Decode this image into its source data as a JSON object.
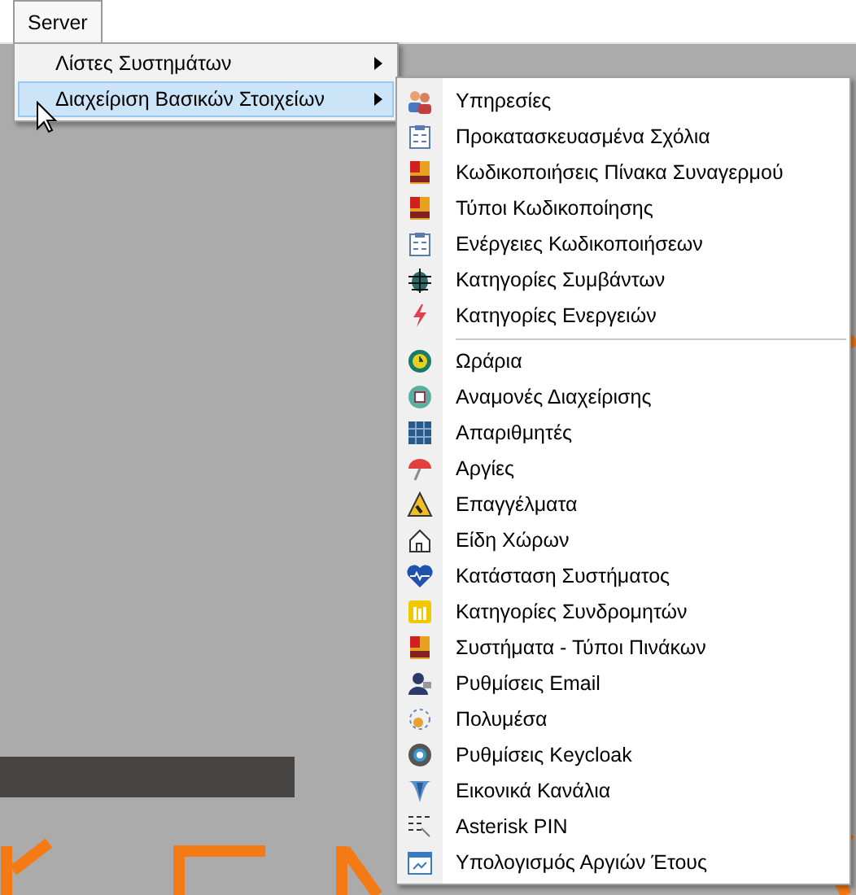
{
  "menubar": [
    {
      "label": "Server",
      "selected": true
    }
  ],
  "menu": {
    "items": [
      {
        "label": "Λίστες Συστημάτων",
        "selected": false
      },
      {
        "label": "Διαχείριση Βασικών Στοιχείων",
        "selected": true
      }
    ]
  },
  "submenu": {
    "groups": [
      [
        {
          "label": "Υπηρεσίες"
        },
        {
          "label": "Προκατασκευασμένα Σχόλια"
        },
        {
          "label": "Κωδικοποιήσεις Πίνακα Συναγερμού"
        },
        {
          "label": "Τύποι Κωδικοποίησης"
        },
        {
          "label": "Ενέργειες Κωδικοποιήσεων"
        },
        {
          "label": "Κατηγορίες Συμβάντων"
        },
        {
          "label": "Κατηγορίες Ενεργειών"
        }
      ],
      [
        {
          "label": "Ωράρια"
        },
        {
          "label": "Αναμονές Διαχείρισης"
        },
        {
          "label": "Απαριθμητές"
        },
        {
          "label": "Αργίες"
        },
        {
          "label": "Επαγγέλματα"
        },
        {
          "label": "Είδη Χώρων"
        },
        {
          "label": "Κατάσταση Συστήματος"
        },
        {
          "label": "Κατηγορίες Συνδρομητών"
        },
        {
          "label": "Συστήματα - Τύποι Πινάκων"
        },
        {
          "label": "Ρυθμίσεις Email"
        },
        {
          "label": "Πολυμέσα"
        },
        {
          "label": "Ρυθμίσεις Keycloak"
        },
        {
          "label": "Εικονικά Κανάλια"
        },
        {
          "label": "Asterisk PIN"
        },
        {
          "label": "Υπολογισμός Αργιών Έτους"
        }
      ]
    ]
  }
}
